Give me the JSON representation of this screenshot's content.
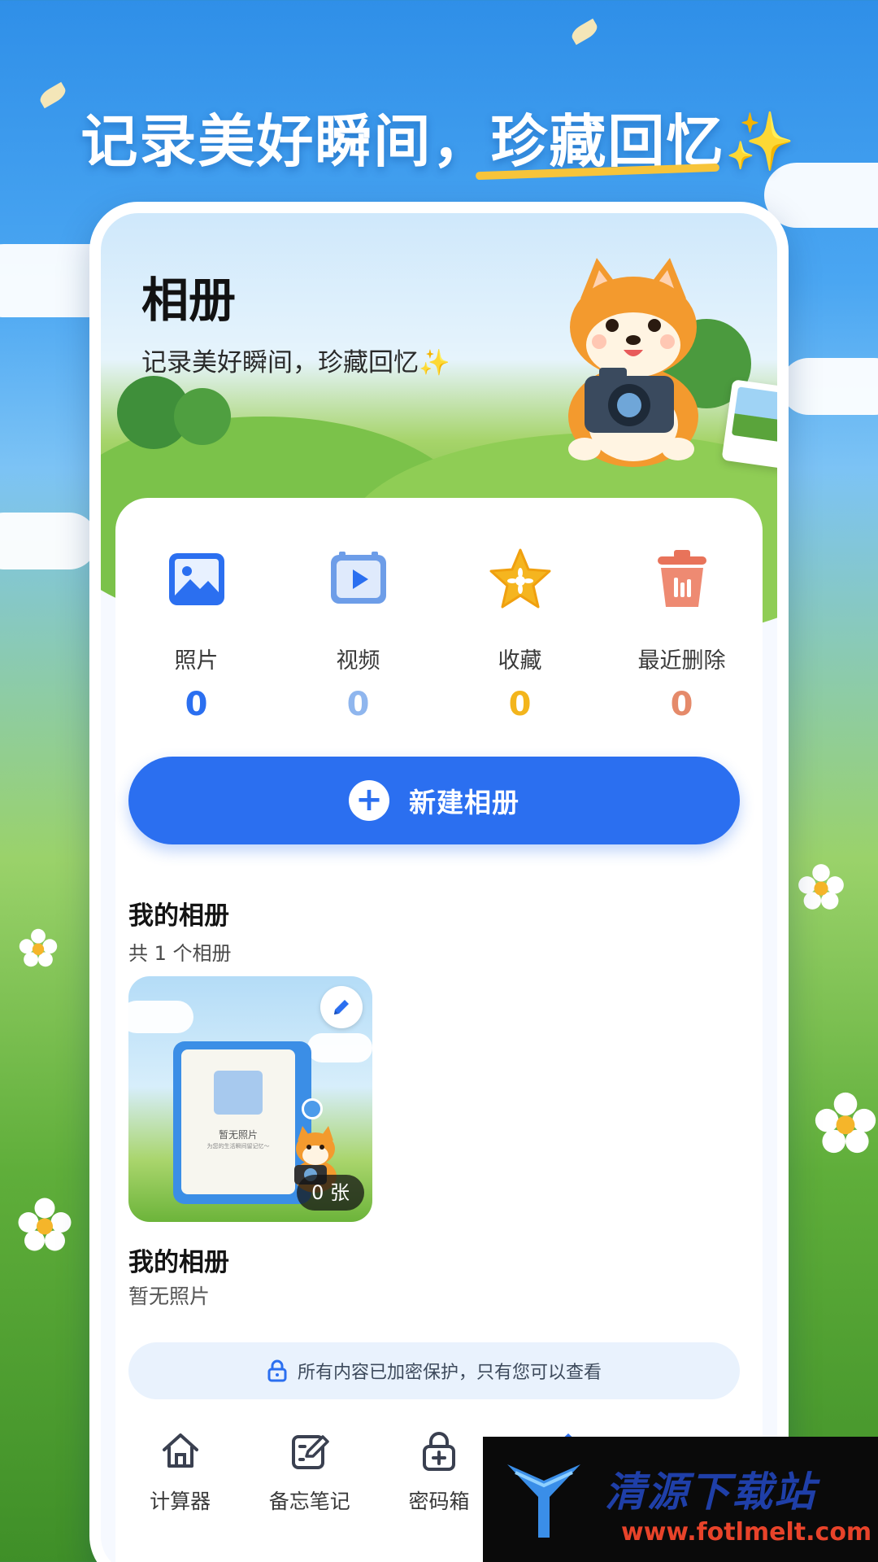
{
  "headline": {
    "text": "记录美好瞬间，珍藏回忆",
    "sparkle": "✨"
  },
  "hero": {
    "title": "相册",
    "subtitle": "记录美好瞬间，珍藏回忆",
    "sparkle": "✨"
  },
  "stats": [
    {
      "label": "照片",
      "count": "0",
      "icon": "photo-icon",
      "color": "#2b6ff0"
    },
    {
      "label": "视频",
      "count": "0",
      "icon": "video-icon",
      "color": "#8fb6ee"
    },
    {
      "label": "收藏",
      "count": "0",
      "icon": "star-icon",
      "color": "#f3b51c"
    },
    {
      "label": "最近删除",
      "count": "0",
      "icon": "trash-icon",
      "color": "#e58a6a"
    }
  ],
  "new_album_label": "新建相册",
  "my_albums": {
    "title": "我的相册",
    "count_text": "共 1 个相册"
  },
  "album": {
    "name": "我的相册",
    "description": "暂无照片",
    "photo_count": "0 张",
    "cover_empty_text": "暂无照片",
    "cover_empty_sub": "为您的生活瞬间留记忆～"
  },
  "secure_notice": "所有内容已加密保护，只有您可以查看",
  "nav": [
    {
      "label": "计算器",
      "icon": "home-icon"
    },
    {
      "label": "备忘笔记",
      "icon": "note-edit-icon"
    },
    {
      "label": "密码箱",
      "icon": "lock-box-icon"
    }
  ],
  "watermark": {
    "title": "清源下载站",
    "url": "www.fotlmelt.com"
  },
  "colors": {
    "primary": "#2b6ff0",
    "secure_bg": "#e9f2fd"
  }
}
